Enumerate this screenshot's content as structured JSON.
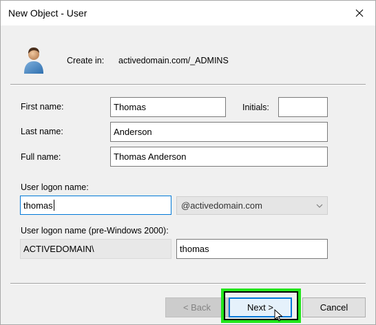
{
  "window": {
    "title": "New Object - User"
  },
  "header": {
    "create_in_label": "Create in:",
    "create_in_path": "activedomain.com/_ADMINS"
  },
  "form": {
    "first_name_label": "First name:",
    "first_name_value": "Thomas",
    "initials_label": "Initials:",
    "initials_value": "",
    "last_name_label": "Last name:",
    "last_name_value": "Anderson",
    "full_name_label": "Full name:",
    "full_name_value": "Thomas Anderson",
    "logon_name_label": "User logon name:",
    "logon_name_value": "thomas",
    "domain_suffix_value": "@activedomain.com",
    "pre2000_label": "User logon name (pre-Windows 2000):",
    "pre2000_domain_value": "ACTIVEDOMAIN\\",
    "pre2000_name_value": "thomas"
  },
  "buttons": {
    "back_label": "< Back",
    "next_label": "Next >",
    "cancel_label": "Cancel"
  },
  "colors": {
    "highlight": "#22e61b",
    "focus_border": "#0078d7"
  },
  "icons": {
    "avatar": "user-avatar-icon",
    "close": "close-icon",
    "dropdown": "chevron-down-icon",
    "cursor": "mouse-pointer-icon"
  }
}
